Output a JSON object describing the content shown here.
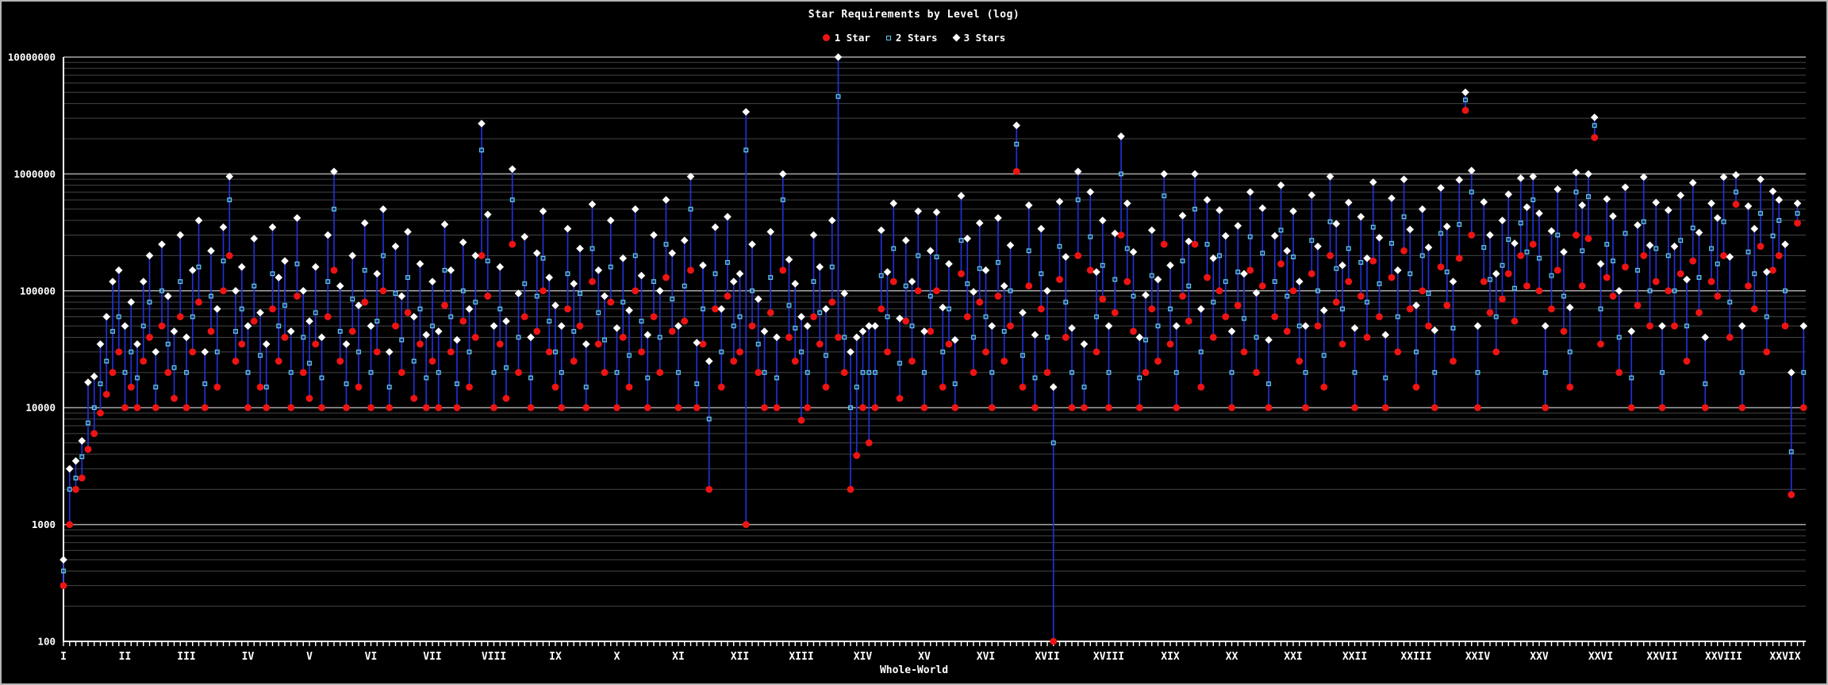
{
  "title": "Star Requirements by Level (log)",
  "legend": {
    "items": [
      {
        "label": "1 Star",
        "marker": "circle-icon",
        "color": "#ee1414"
      },
      {
        "label": "2 Stars",
        "marker": "square-icon",
        "color": "#63cbe8"
      },
      {
        "label": "3 Stars",
        "marker": "diamond-icon",
        "color": "#ffffff"
      }
    ]
  },
  "colors": {
    "background": "#000000",
    "frame": "#b4b4b4",
    "stem": "#2130d4",
    "star1": "#ee1414",
    "star2": "#63cbe8",
    "star3": "#ffffff",
    "grid_major": "#a8a8a8",
    "grid_minor": "#454545",
    "axis": "#ffffff",
    "text": "#ffffff"
  },
  "chart_data": {
    "type": "scatter",
    "subtype": "stem-range-log",
    "title": "Star Requirements by Level (log)",
    "xlabel": "Whole-World",
    "ylabel": "",
    "log_scale_y": true,
    "ylim": [
      100,
      10000000
    ],
    "y_ticks": [
      100,
      1000,
      10000,
      100000,
      1000000,
      10000000
    ],
    "y_tick_labels": [
      "100",
      "1000",
      "10000",
      "100000",
      "1000000",
      "10000000"
    ],
    "grid": "log-minor-and-major",
    "legend_position": "top-center",
    "x_world_labels": [
      "I",
      "II",
      "III",
      "IV",
      "V",
      "VI",
      "VII",
      "VIII",
      "IX",
      "X",
      "XI",
      "XII",
      "XIII",
      "XIV",
      "XV",
      "XVI",
      "XVII",
      "XVIII",
      "XIX",
      "XX",
      "XXI",
      "XXII",
      "XXIII",
      "XXIV",
      "XXV",
      "XXVI",
      "XXVII",
      "XXVIII",
      "XXVIX"
    ],
    "levels_per_world": 10,
    "n_levels": 284,
    "series": [
      {
        "name": "1 Star",
        "marker": "circle",
        "values": [
          300,
          1000,
          2000,
          2500,
          4400,
          6000,
          9000,
          13000,
          20000,
          30000,
          10000,
          15000,
          10000,
          25000,
          40000,
          10000,
          50000,
          20000,
          12000,
          60000,
          10000,
          30000,
          80000,
          10000,
          45000,
          15000,
          100000,
          200000,
          25000,
          35000,
          10000,
          55000,
          15000,
          10000,
          70000,
          25000,
          40000,
          10000,
          90000,
          20000,
          12000,
          35000,
          10000,
          60000,
          150000,
          25000,
          10000,
          45000,
          15000,
          80000,
          10000,
          30000,
          100000,
          10000,
          50000,
          20000,
          65000,
          12000,
          35000,
          10000,
          25000,
          10000,
          75000,
          30000,
          10000,
          55000,
          15000,
          40000,
          200000,
          90000,
          10000,
          35000,
          12000,
          250000,
          20000,
          60000,
          10000,
          45000,
          100000,
          30000,
          15000,
          10000,
          70000,
          25000,
          50000,
          10000,
          120000,
          35000,
          20000,
          80000,
          10000,
          40000,
          15000,
          100000,
          30000,
          10000,
          60000,
          20000,
          130000,
          45000,
          10000,
          55000,
          150000,
          10000,
          35000,
          2000,
          70000,
          15000,
          90000,
          25000,
          30000,
          1000,
          50000,
          20000,
          10000,
          65000,
          10000,
          150000,
          40000,
          25000,
          7800,
          10000,
          60000,
          35000,
          15000,
          80000,
          40000,
          20000,
          2000,
          3900,
          10000,
          5000,
          10000,
          70000,
          30000,
          120000,
          12000,
          55000,
          25000,
          100000,
          10000,
          45000,
          100000,
          15000,
          35000,
          10000,
          140000,
          60000,
          20000,
          80000,
          30000,
          10000,
          90000,
          25000,
          50000,
          1050000,
          15000,
          110000,
          10000,
          70000,
          20000,
          100,
          125000,
          40000,
          10000,
          200000,
          10000,
          150000,
          30000,
          85000,
          10000,
          65000,
          300000,
          120000,
          45000,
          10000,
          20000,
          70000,
          25000,
          250000,
          35000,
          10000,
          90000,
          55000,
          250000,
          15000,
          130000,
          40000,
          100000,
          60000,
          10000,
          75000,
          30000,
          150000,
          20000,
          110000,
          10000,
          60000,
          170000,
          45000,
          100000,
          25000,
          10000,
          140000,
          50000,
          15000,
          200000,
          80000,
          35000,
          120000,
          10000,
          90000,
          40000,
          180000,
          60000,
          10000,
          130000,
          30000,
          220000,
          70000,
          15000,
          100000,
          50000,
          10000,
          160000,
          75000,
          25000,
          190000,
          3500000,
          300000,
          10000,
          120000,
          65000,
          30000,
          85000,
          140000,
          55000,
          200000,
          110000,
          250000,
          100000,
          10000,
          70000,
          150000,
          45000,
          15000,
          300000,
          110000,
          280000,
          2050000,
          35000,
          130000,
          90000,
          20000,
          160000,
          10000,
          75000,
          200000,
          50000,
          120000,
          10000,
          100000,
          50000,
          140000,
          25000,
          180000,
          65000,
          10000,
          120000,
          90000,
          200000,
          40000,
          550000,
          10000,
          110000,
          70000,
          240000,
          30000,
          150000,
          200000,
          50000,
          1800,
          380000,
          10000
        ]
      },
      {
        "name": "2 Stars",
        "marker": "open-square",
        "values": [
          400,
          2000,
          2500,
          3800,
          7400,
          10000,
          16000,
          25000,
          45000,
          60000,
          20000,
          30000,
          18000,
          50000,
          80000,
          15000,
          100000,
          35000,
          22000,
          120000,
          20000,
          60000,
          160000,
          16000,
          90000,
          30000,
          180000,
          600000,
          45000,
          70000,
          20000,
          110000,
          28000,
          15000,
          140000,
          50000,
          75000,
          20000,
          170000,
          40000,
          24000,
          65000,
          18000,
          120000,
          500000,
          45000,
          16000,
          85000,
          30000,
          150000,
          20000,
          55000,
          200000,
          15000,
          95000,
          38000,
          130000,
          25000,
          70000,
          18000,
          50000,
          20000,
          150000,
          60000,
          16000,
          100000,
          30000,
          80000,
          1600000,
          180000,
          20000,
          70000,
          22000,
          600000,
          40000,
          115000,
          18000,
          90000,
          190000,
          55000,
          30000,
          20000,
          140000,
          45000,
          95000,
          15000,
          230000,
          65000,
          38000,
          160000,
          20000,
          80000,
          28000,
          200000,
          55000,
          18000,
          120000,
          40000,
          250000,
          85000,
          20000,
          110000,
          500000,
          16000,
          70000,
          8000,
          140000,
          30000,
          175000,
          50000,
          60000,
          1600000,
          100000,
          35000,
          20000,
          130000,
          18000,
          600000,
          75000,
          48000,
          30000,
          20000,
          120000,
          65000,
          28000,
          160000,
          4600000,
          40000,
          10000,
          15000,
          20000,
          20000,
          20000,
          135000,
          60000,
          230000,
          24000,
          110000,
          50000,
          200000,
          20000,
          90000,
          195000,
          30000,
          70000,
          16000,
          270000,
          115000,
          40000,
          155000,
          60000,
          20000,
          175000,
          45000,
          100000,
          1800000,
          28000,
          220000,
          18000,
          140000,
          40000,
          5000,
          240000,
          80000,
          20000,
          600000,
          15000,
          290000,
          60000,
          165000,
          20000,
          125000,
          1000000,
          230000,
          90000,
          18000,
          38000,
          135000,
          50000,
          650000,
          70000,
          20000,
          180000,
          110000,
          500000,
          30000,
          250000,
          80000,
          200000,
          120000,
          20000,
          145000,
          58000,
          290000,
          40000,
          210000,
          16000,
          120000,
          330000,
          90000,
          195000,
          50000,
          20000,
          270000,
          100000,
          28000,
          390000,
          155000,
          70000,
          230000,
          20000,
          175000,
          80000,
          350000,
          115000,
          18000,
          255000,
          60000,
          430000,
          140000,
          30000,
          200000,
          95000,
          20000,
          310000,
          145000,
          48000,
          370000,
          4300000,
          700000,
          20000,
          235000,
          125000,
          60000,
          165000,
          275000,
          105000,
          380000,
          215000,
          600000,
          190000,
          20000,
          135000,
          300000,
          90000,
          30000,
          700000,
          220000,
          640000,
          2600000,
          70000,
          250000,
          180000,
          40000,
          310000,
          18000,
          150000,
          390000,
          100000,
          230000,
          20000,
          200000,
          100000,
          270000,
          50000,
          345000,
          130000,
          16000,
          230000,
          170000,
          390000,
          80000,
          700000,
          20000,
          215000,
          140000,
          460000,
          60000,
          295000,
          400000,
          100000,
          4200,
          460000,
          20000
        ]
      },
      {
        "name": "3 Stars",
        "marker": "diamond",
        "values": [
          500,
          3000,
          3500,
          5200,
          16500,
          18500,
          35000,
          60000,
          120000,
          150000,
          50000,
          80000,
          35000,
          120000,
          200000,
          30000,
          250000,
          90000,
          45000,
          300000,
          40000,
          150000,
          400000,
          30000,
          220000,
          70000,
          350000,
          950000,
          100000,
          160000,
          50000,
          280000,
          65000,
          35000,
          350000,
          130000,
          180000,
          45000,
          420000,
          100000,
          55000,
          160000,
          40000,
          300000,
          1050000,
          110000,
          35000,
          200000,
          75000,
          380000,
          50000,
          140000,
          500000,
          30000,
          240000,
          90000,
          320000,
          60000,
          170000,
          42000,
          120000,
          45000,
          370000,
          150000,
          38000,
          260000,
          70000,
          200000,
          2700000,
          450000,
          50000,
          160000,
          55000,
          1100000,
          95000,
          290000,
          40000,
          210000,
          480000,
          130000,
          75000,
          50000,
          340000,
          115000,
          230000,
          35000,
          550000,
          150000,
          90000,
          400000,
          48000,
          190000,
          68000,
          500000,
          135000,
          42000,
          300000,
          100000,
          600000,
          210000,
          50000,
          270000,
          950000,
          36000,
          165000,
          25000,
          350000,
          70000,
          430000,
          120000,
          140000,
          3400000,
          250000,
          85000,
          45000,
          320000,
          40000,
          1000000,
          185000,
          115000,
          60000,
          50000,
          300000,
          160000,
          70000,
          400000,
          10000000,
          95000,
          30000,
          40000,
          45000,
          50000,
          50000,
          330000,
          145000,
          560000,
          58000,
          270000,
          120000,
          480000,
          45000,
          220000,
          470000,
          72000,
          170000,
          38000,
          650000,
          280000,
          98000,
          380000,
          150000,
          50000,
          420000,
          110000,
          245000,
          2600000,
          65000,
          540000,
          42000,
          340000,
          100000,
          15000,
          580000,
          195000,
          48000,
          1050000,
          35000,
          700000,
          145000,
          400000,
          50000,
          310000,
          2100000,
          560000,
          215000,
          40000,
          92000,
          330000,
          125000,
          1000000,
          165000,
          50000,
          440000,
          265000,
          1000000,
          70000,
          600000,
          190000,
          490000,
          295000,
          45000,
          360000,
          140000,
          700000,
          96000,
          510000,
          38000,
          295000,
          800000,
          220000,
          480000,
          120000,
          50000,
          660000,
          240000,
          68000,
          950000,
          375000,
          165000,
          570000,
          48000,
          430000,
          190000,
          850000,
          285000,
          42000,
          620000,
          150000,
          900000,
          335000,
          75000,
          500000,
          235000,
          46000,
          760000,
          355000,
          120000,
          890000,
          5000000,
          1070000,
          50000,
          575000,
          300000,
          140000,
          400000,
          670000,
          255000,
          920000,
          520000,
          950000,
          460000,
          50000,
          325000,
          740000,
          215000,
          72000,
          1030000,
          540000,
          1000000,
          3050000,
          170000,
          610000,
          435000,
          100000,
          770000,
          45000,
          365000,
          940000,
          245000,
          570000,
          50000,
          490000,
          240000,
          655000,
          125000,
          840000,
          315000,
          40000,
          560000,
          420000,
          940000,
          195000,
          980000,
          50000,
          530000,
          340000,
          900000,
          145000,
          710000,
          600000,
          250000,
          20000,
          560000,
          50000
        ]
      }
    ]
  }
}
